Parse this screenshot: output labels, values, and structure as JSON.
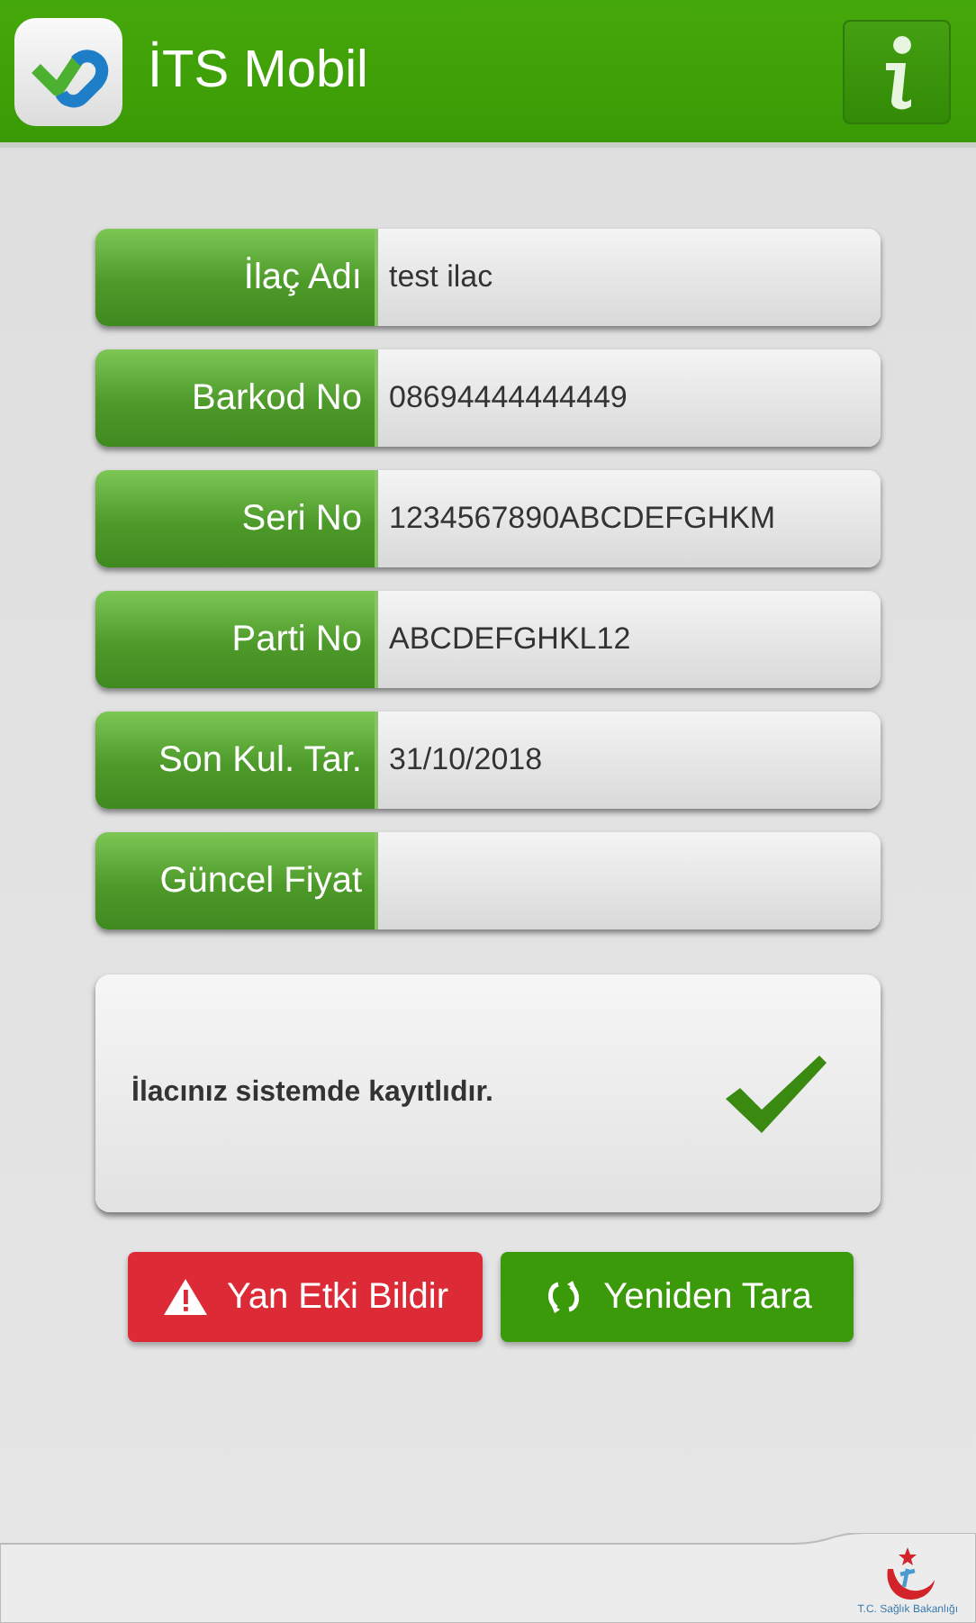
{
  "app_bar": {
    "title": "İTS Mobil"
  },
  "fields": [
    {
      "label": "İlaç Adı",
      "value": "test ilac"
    },
    {
      "label": "Barkod No",
      "value": "08694444444449"
    },
    {
      "label": "Seri No",
      "value": "1234567890ABCDEFGHKM"
    },
    {
      "label": "Parti No",
      "value": "ABCDEFGHKL12"
    },
    {
      "label": "Son Kul. Tar.",
      "value": "31/10/2018"
    },
    {
      "label": "Güncel Fiyat"
    }
  ],
  "result": {
    "message": "İlacınız sistemde kayıtlıdır.",
    "kind": "registered"
  },
  "buttons": [
    {
      "label": "Yan Etki Bildir",
      "kind": "report"
    },
    {
      "label": "Yeniden Tara",
      "kind": "rescan"
    }
  ],
  "footer": {
    "logo_caption": "T.C. Sağlık Bakanlığı"
  }
}
